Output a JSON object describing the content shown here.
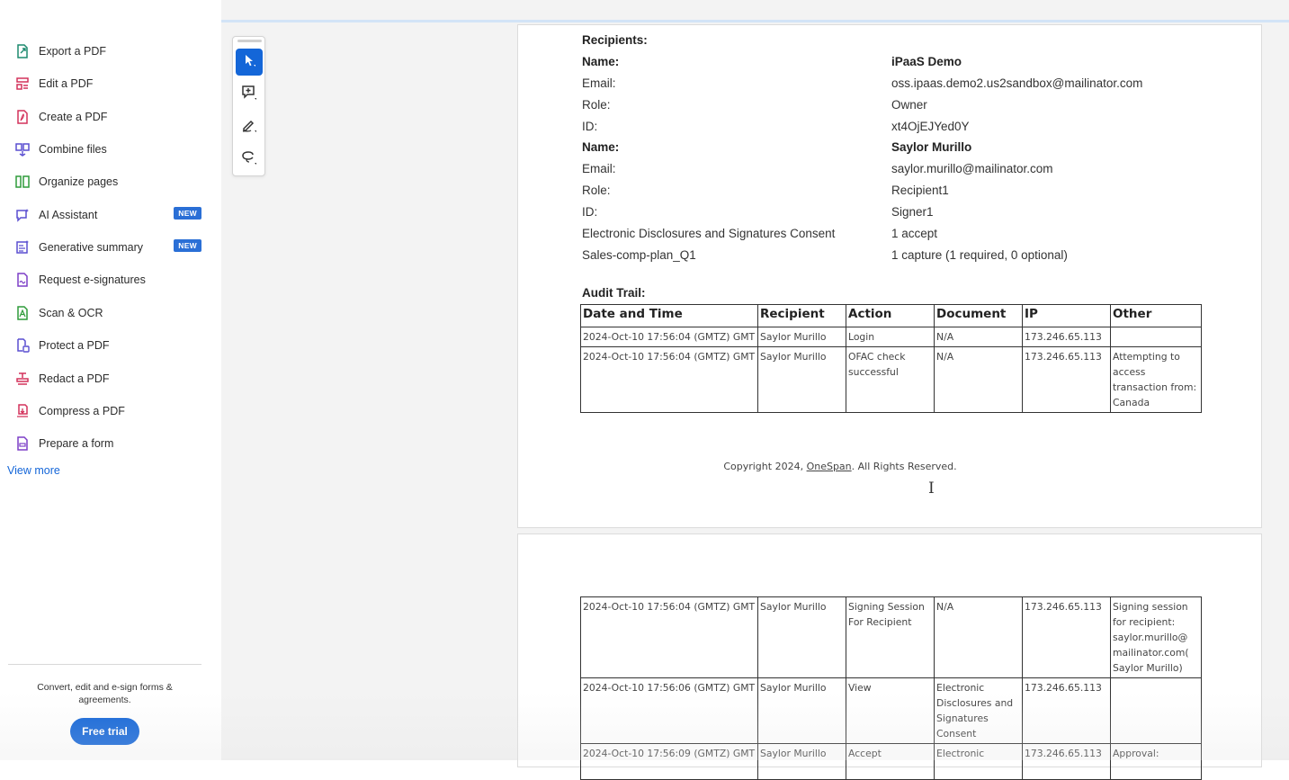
{
  "sidebar": {
    "items": [
      {
        "label": "Export a PDF",
        "icon": "export-pdf-icon",
        "color": "#1d8a6f"
      },
      {
        "label": "Edit a PDF",
        "icon": "edit-pdf-icon",
        "color": "#d3325b"
      },
      {
        "label": "Create a PDF",
        "icon": "create-pdf-icon",
        "color": "#d3325b"
      },
      {
        "label": "Combine files",
        "icon": "combine-files-icon",
        "color": "#5a4fd1"
      },
      {
        "label": "Organize pages",
        "icon": "organize-pages-icon",
        "color": "#2f9b3a"
      },
      {
        "label": "AI Assistant",
        "icon": "ai-assistant-icon",
        "color": "#5a4fd1",
        "badge": "NEW"
      },
      {
        "label": "Generative summary",
        "icon": "generative-summary-icon",
        "color": "#5a4fd1",
        "badge": "NEW"
      },
      {
        "label": "Request e-signatures",
        "icon": "request-esignatures-icon",
        "color": "#7d3fc7"
      },
      {
        "label": "Scan & OCR",
        "icon": "scan-ocr-icon",
        "color": "#2f9b3a"
      },
      {
        "label": "Protect a PDF",
        "icon": "protect-pdf-icon",
        "color": "#5a4fd1"
      },
      {
        "label": "Redact a PDF",
        "icon": "redact-pdf-icon",
        "color": "#d3325b"
      },
      {
        "label": "Compress a PDF",
        "icon": "compress-pdf-icon",
        "color": "#d3325b"
      },
      {
        "label": "Prepare a form",
        "icon": "prepare-form-icon",
        "color": "#7d3fc7"
      }
    ],
    "view_more": "View more",
    "promo": "Convert, edit and e-sign forms & agreements.",
    "free_trial": "Free trial"
  },
  "toolbar": {
    "tools": [
      "select-cursor-icon",
      "add-comment-icon",
      "draw-pen-icon",
      "lasso-icon"
    ],
    "accent": "#1466d8"
  },
  "document": {
    "recipients_heading": "Recipients:",
    "recipients": [
      {
        "name_label": "Name:",
        "name": "iPaaS Demo",
        "email_label": "Email:",
        "email": "oss.ipaas.demo2.us2sandbox@mailinator.com",
        "role_label": "Role:",
        "role": "Owner",
        "id_label": "ID:",
        "id": "xt4OjEJYed0Y"
      },
      {
        "name_label": "Name:",
        "name": "Saylor Murillo",
        "email_label": "Email:",
        "email": "saylor.murillo@mailinator.com",
        "role_label": "Role:",
        "role": "Recipient1",
        "id_label": "ID:",
        "id": "Signer1"
      }
    ],
    "extra_rows": [
      {
        "label": "Electronic Disclosures and Signatures Consent",
        "value": "1 accept"
      },
      {
        "label": "Sales-comp-plan_Q1",
        "value": "1 capture (1 required, 0 optional)"
      }
    ],
    "audit_heading": "Audit Trail:",
    "audit_columns": [
      "Date and Time",
      "Recipient",
      "Action",
      "Document",
      "IP",
      "Other"
    ],
    "audit_rows_page1": [
      [
        "2024-Oct-10 17:56:04 (GMTZ) GMT",
        "Saylor Murillo",
        "Login",
        "N/A",
        "173.246.65.113",
        ""
      ],
      [
        "2024-Oct-10 17:56:04 (GMTZ) GMT",
        "Saylor Murillo",
        "OFAC check successful",
        "N/A",
        "173.246.65.113",
        "Attempting to access transaction from: Canada"
      ]
    ],
    "audit_rows_page2": [
      [
        "2024-Oct-10 17:56:04 (GMTZ) GMT",
        "Saylor Murillo",
        "Signing Session For Recipient",
        "N/A",
        "173.246.65.113",
        "Signing session for recipient: saylor.murillo@ mailinator.com( Saylor Murillo)"
      ],
      [
        "2024-Oct-10 17:56:06 (GMTZ) GMT",
        "Saylor Murillo",
        "View",
        "Electronic Disclosures and Signatures Consent",
        "173.246.65.113",
        ""
      ],
      [
        "2024-Oct-10 17:56:09 (GMTZ) GMT",
        "Saylor Murillo",
        "Accept",
        "Electronic",
        "173.246.65.113",
        "Approval:"
      ]
    ],
    "copyright_prefix": "Copyright 2024, ",
    "copyright_link": "OneSpan",
    "copyright_suffix": ". All Rights Reserved."
  }
}
